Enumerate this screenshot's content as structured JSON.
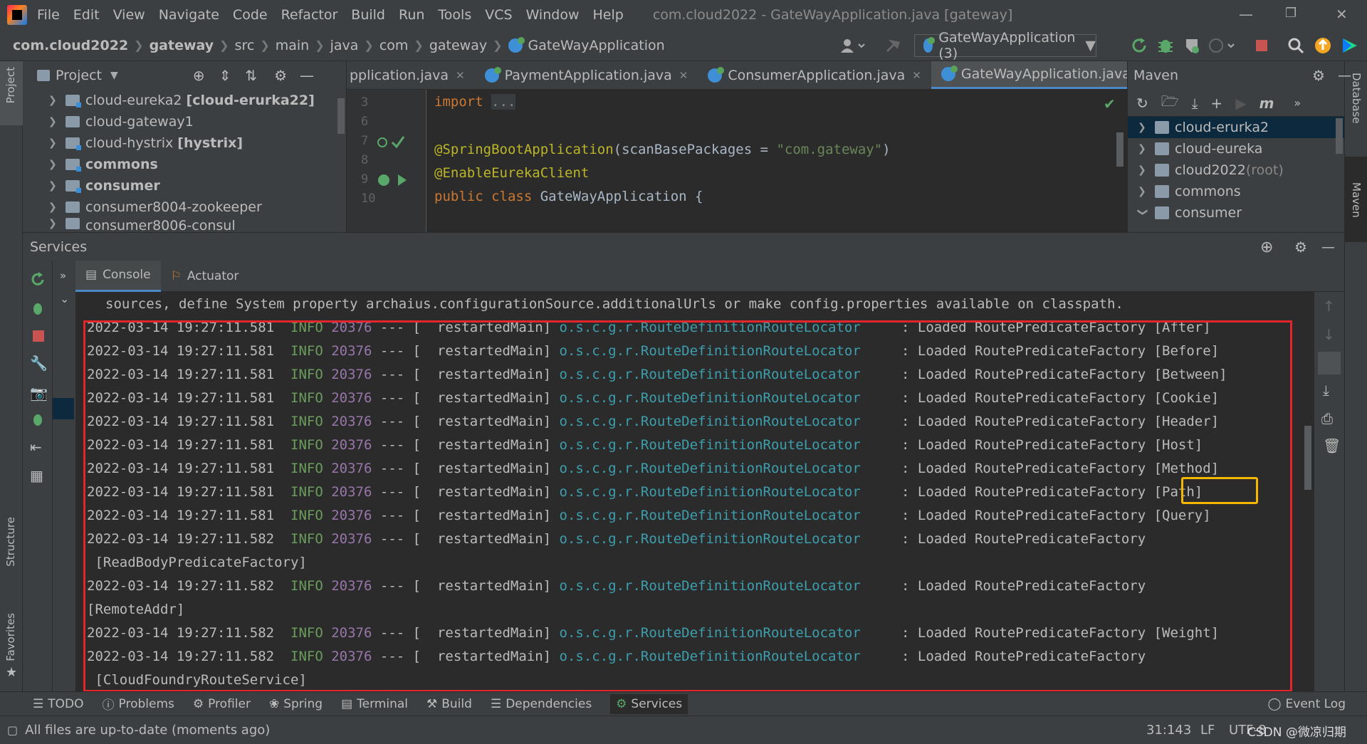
{
  "menubar": {
    "items": [
      "File",
      "Edit",
      "View",
      "Navigate",
      "Code",
      "Refactor",
      "Build",
      "Run",
      "Tools",
      "VCS",
      "Window",
      "Help"
    ],
    "window_title": "com.cloud2022 - GateWayApplication.java [gateway]"
  },
  "breadcrumb": [
    "com.cloud2022",
    "gateway",
    "src",
    "main",
    "java",
    "com",
    "gateway",
    "GateWayApplication"
  ],
  "run_config": "GateWayApplication (3)",
  "project": {
    "title": "Project",
    "items": [
      {
        "name": "cloud-eureka2",
        "module": "[cloud-erurka22]"
      },
      {
        "name": "cloud-gateway1",
        "module": ""
      },
      {
        "name": "cloud-hystrix",
        "module": "[hystrix]"
      },
      {
        "name": "commons",
        "module": ""
      },
      {
        "name": "consumer",
        "module": ""
      },
      {
        "name": "consumer8004-zookeeper",
        "module": ""
      },
      {
        "name": "consumer8006-consul",
        "module": ""
      }
    ]
  },
  "editor": {
    "tabs": [
      "pplication.java",
      "PaymentApplication.java",
      "ConsumerApplication.java",
      "GateWayApplication.java"
    ],
    "line_numbers": [
      "3",
      "6",
      "7",
      "8",
      "9",
      "10"
    ],
    "code": {
      "import_kw": "import",
      "import_fold": "...",
      "ann1": "@SpringBootApplication",
      "ann1_args_a": "(scanBasePackages = ",
      "ann1_str": "\"com.gateway\"",
      "ann1_args_b": ")",
      "ann2": "@EnableEurekaClient",
      "class_kw": "public class",
      "class_name": " GateWayApplication {"
    }
  },
  "maven": {
    "title": "Maven",
    "items": [
      {
        "name": "cloud-erurka2",
        "suffix": ""
      },
      {
        "name": "cloud-eureka",
        "suffix": ""
      },
      {
        "name": "cloud2022",
        "suffix": " (root)"
      },
      {
        "name": "commons",
        "suffix": ""
      },
      {
        "name": "consumer",
        "suffix": ""
      }
    ]
  },
  "services": {
    "title": "Services",
    "tabs": [
      "Console",
      "Actuator"
    ],
    "first_line": "sources, define System property archaius.configurationSource.additionalUrls or make config.properties available on classpath.",
    "log_lines": [
      {
        "time": "2022-03-14 19:27:11.581",
        "level": "INFO",
        "pid": "20376",
        "thread": "--- [  restartedMain]",
        "logger": "o.s.c.g.r.RouteDefinitionRouteLocator",
        "msg": "    : Loaded RoutePredicateFactory [After]",
        "cont": ""
      },
      {
        "time": "2022-03-14 19:27:11.581",
        "level": "INFO",
        "pid": "20376",
        "thread": "--- [  restartedMain]",
        "logger": "o.s.c.g.r.RouteDefinitionRouteLocator",
        "msg": "    : Loaded RoutePredicateFactory [Before]",
        "cont": ""
      },
      {
        "time": "2022-03-14 19:27:11.581",
        "level": "INFO",
        "pid": "20376",
        "thread": "--- [  restartedMain]",
        "logger": "o.s.c.g.r.RouteDefinitionRouteLocator",
        "msg": "    : Loaded RoutePredicateFactory [Between]",
        "cont": ""
      },
      {
        "time": "2022-03-14 19:27:11.581",
        "level": "INFO",
        "pid": "20376",
        "thread": "--- [  restartedMain]",
        "logger": "o.s.c.g.r.RouteDefinitionRouteLocator",
        "msg": "    : Loaded RoutePredicateFactory [Cookie]",
        "cont": ""
      },
      {
        "time": "2022-03-14 19:27:11.581",
        "level": "INFO",
        "pid": "20376",
        "thread": "--- [  restartedMain]",
        "logger": "o.s.c.g.r.RouteDefinitionRouteLocator",
        "msg": "    : Loaded RoutePredicateFactory [Header]",
        "cont": ""
      },
      {
        "time": "2022-03-14 19:27:11.581",
        "level": "INFO",
        "pid": "20376",
        "thread": "--- [  restartedMain]",
        "logger": "o.s.c.g.r.RouteDefinitionRouteLocator",
        "msg": "    : Loaded RoutePredicateFactory [Host]",
        "cont": ""
      },
      {
        "time": "2022-03-14 19:27:11.581",
        "level": "INFO",
        "pid": "20376",
        "thread": "--- [  restartedMain]",
        "logger": "o.s.c.g.r.RouteDefinitionRouteLocator",
        "msg": "    : Loaded RoutePredicateFactory [Method]",
        "cont": ""
      },
      {
        "time": "2022-03-14 19:27:11.581",
        "level": "INFO",
        "pid": "20376",
        "thread": "--- [  restartedMain]",
        "logger": "o.s.c.g.r.RouteDefinitionRouteLocator",
        "msg": "    : Loaded RoutePredicateFactory [Path]",
        "cont": ""
      },
      {
        "time": "2022-03-14 19:27:11.581",
        "level": "INFO",
        "pid": "20376",
        "thread": "--- [  restartedMain]",
        "logger": "o.s.c.g.r.RouteDefinitionRouteLocator",
        "msg": "    : Loaded RoutePredicateFactory [Query]",
        "cont": ""
      },
      {
        "time": "2022-03-14 19:27:11.582",
        "level": "INFO",
        "pid": "20376",
        "thread": "--- [  restartedMain]",
        "logger": "o.s.c.g.r.RouteDefinitionRouteLocator",
        "msg": "    : Loaded RoutePredicateFactory",
        "cont": " [ReadBodyPredicateFactory]"
      },
      {
        "time": "2022-03-14 19:27:11.582",
        "level": "INFO",
        "pid": "20376",
        "thread": "--- [  restartedMain]",
        "logger": "o.s.c.g.r.RouteDefinitionRouteLocator",
        "msg": "    : Loaded RoutePredicateFactory",
        "cont": "[RemoteAddr]"
      },
      {
        "time": "2022-03-14 19:27:11.582",
        "level": "INFO",
        "pid": "20376",
        "thread": "--- [  restartedMain]",
        "logger": "o.s.c.g.r.RouteDefinitionRouteLocator",
        "msg": "    : Loaded RoutePredicateFactory [Weight]",
        "cont": ""
      },
      {
        "time": "2022-03-14 19:27:11.582",
        "level": "INFO",
        "pid": "20376",
        "thread": "--- [  restartedMain]",
        "logger": "o.s.c.g.r.RouteDefinitionRouteLocator",
        "msg": "    : Loaded RoutePredicateFactory",
        "cont": " [CloudFoundryRouteService]"
      }
    ]
  },
  "toolwindows": [
    "TODO",
    "Problems",
    "Profiler",
    "Spring",
    "Terminal",
    "Build",
    "Dependencies",
    "Services"
  ],
  "event_log": "Event Log",
  "side_labels": {
    "project": "Project",
    "structure": "Structure",
    "favorites": "Favorites",
    "database": "Database",
    "maven": "Maven"
  },
  "status": {
    "message": "All files are up-to-date (moments ago)",
    "position": "31:143",
    "line_sep": "LF",
    "encoding": "UTF-8"
  },
  "watermark": "CSDN @微凉归期",
  "colors": {
    "highlight_box": "#e3262b",
    "path_box": "#f5b800",
    "info": "#6a9d5b",
    "logger": "#3d9fae",
    "pid": "#9876aa"
  }
}
